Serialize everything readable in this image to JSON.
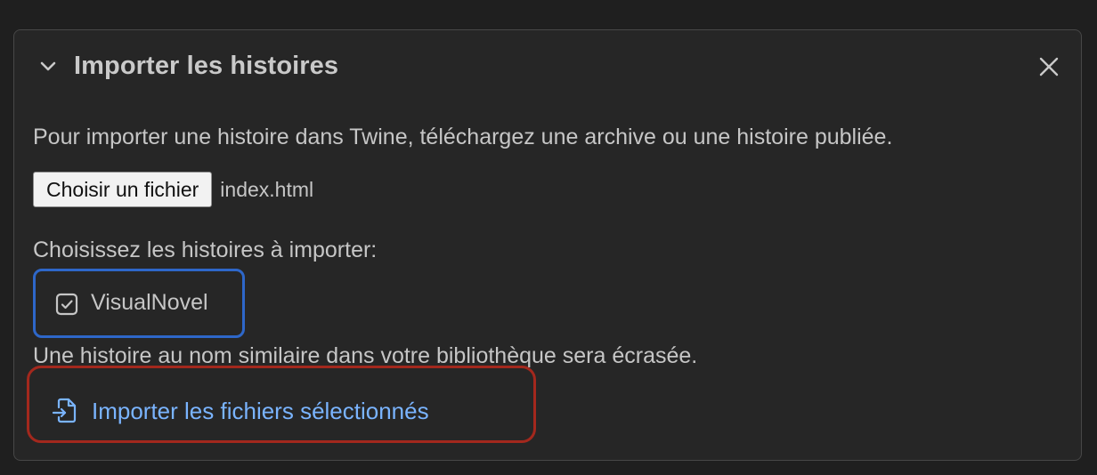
{
  "dialog": {
    "title": "Importer les histoires",
    "collapse_icon": "chevron-down-icon",
    "close_icon": "close-icon"
  },
  "content": {
    "description": "Pour importer une histoire dans Twine, téléchargez une archive ou une histoire publiée.",
    "file_button_label": "Choisir un fichier",
    "file_name": "index.html",
    "choose_label": "Choisissez les histoires à importer:",
    "stories": [
      {
        "label": "VisualNovel",
        "checked": true,
        "icon": "checkbox-checked-icon"
      }
    ],
    "warning": "Une histoire au nom similaire dans votre bibliothèque sera écrasée.",
    "import_button_label": "Importer les fichiers sélectionnés",
    "import_icon": "file-import-icon"
  },
  "colors": {
    "background": "#1f1f1f",
    "panel": "#262626",
    "text": "#c6c6c6",
    "link": "#7ab4ff",
    "focus_blue": "#2e67c9",
    "highlight_red": "#a3281d"
  }
}
